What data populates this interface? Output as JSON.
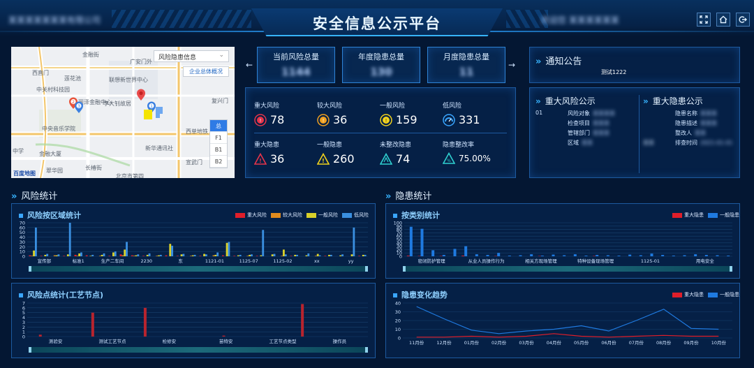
{
  "header": {
    "title": "安全信息公示平台",
    "left_blurred": "某某某某某某某有限公司",
    "right_blurred": "欢迎您 某某某某某某",
    "fullscreen_icon": "expand-icon",
    "home_icon": "home-icon",
    "logout_icon": "logout-icon"
  },
  "map": {
    "select_value": "风险隐患信息",
    "overview_button": "企业总体概况",
    "floors": [
      "总",
      "F1",
      "B1",
      "B2"
    ],
    "labels": [
      {
        "text": "金融街"
      },
      {
        "text": "广安门外"
      },
      {
        "text": "西直门"
      },
      {
        "text": "莲花池"
      },
      {
        "text": "丽泽金融中心"
      },
      {
        "text": "联想新世界中心"
      },
      {
        "text": "中关村科技园"
      },
      {
        "text": "李大钊故居"
      },
      {
        "text": "中央音乐学院"
      },
      {
        "text": "复兴门"
      },
      {
        "text": "新华通讯社"
      },
      {
        "text": "中学"
      },
      {
        "text": "金融大厦"
      },
      {
        "text": "翠华园"
      },
      {
        "text": "长椿街"
      },
      {
        "text": "北京市第四"
      },
      {
        "text": "宣武门"
      },
      {
        "text": "西单地铁"
      },
      {
        "text": "百度地图"
      }
    ],
    "markers": [
      "1",
      "2",
      "3"
    ]
  },
  "kpis": [
    {
      "label": "当前风险总量",
      "value": "1144"
    },
    {
      "label": "年度隐患总量",
      "value": "130"
    },
    {
      "label": "月度隐患总量",
      "value": "11"
    }
  ],
  "risk_stats": [
    {
      "label": "重大风险",
      "value": "78",
      "color": "#e8344a",
      "icon": "major-risk-icon"
    },
    {
      "label": "较大风险",
      "value": "36",
      "color": "#f0a020",
      "icon": "large-risk-icon"
    },
    {
      "label": "一般风险",
      "value": "159",
      "color": "#f2d21c",
      "icon": "general-risk-icon"
    },
    {
      "label": "低风险",
      "value": "331",
      "color": "#3aa6ff",
      "icon": "low-risk-icon"
    }
  ],
  "hazard_stats": [
    {
      "label": "重大隐患",
      "value": "36",
      "color": "#e8344a",
      "icon": "warning-triangle-icon"
    },
    {
      "label": "一般隐患",
      "value": "260",
      "color": "#f2d21c",
      "icon": "warning-triangle-icon"
    },
    {
      "label": "未整改隐患",
      "value": "74",
      "color": "#2fd0d0",
      "icon": "hazard-pending-icon"
    },
    {
      "label": "隐患整改率",
      "value": "75.00%",
      "color": "#2fd0d0",
      "icon": "hazard-rate-icon"
    }
  ],
  "notice": {
    "title": "通知公告",
    "content": "测试1222"
  },
  "major_risk": {
    "title": "重大风险公示",
    "index": "01",
    "rows": [
      {
        "label": "风险对象",
        "value": "某某某某"
      },
      {
        "label": "检查项目",
        "value": "某某某"
      },
      {
        "label": "管辖部门",
        "value": "某某某"
      },
      {
        "label": "区域",
        "value": "某某"
      }
    ]
  },
  "major_hazard": {
    "title": "重大隐患公示",
    "side_value": "某某",
    "rows": [
      {
        "label": "隐患名称",
        "value": "某某某"
      },
      {
        "label": "隐患描述",
        "value": "某某某"
      },
      {
        "label": "整改人",
        "value": "某某"
      },
      {
        "label": "排查时间",
        "value": "2021-01-01"
      }
    ]
  },
  "sections": {
    "risk": "风险统计",
    "hazard": "隐患统计"
  },
  "charts": {
    "region": {
      "title": "风险按区域统计",
      "legend": [
        "重大风险",
        "较大风险",
        "一般风险",
        "低风险"
      ],
      "colors": [
        "#e01e2a",
        "#e08b1e",
        "#d8d02a",
        "#3a8fe0"
      ]
    },
    "point": {
      "title": "风险点统计(工艺节点)"
    },
    "category": {
      "title": "按类别统计",
      "legend": [
        "重大隐患",
        "一般隐患"
      ],
      "colors": [
        "#e01e2a",
        "#1f7ae0"
      ]
    },
    "trend": {
      "title": "隐患变化趋势",
      "legend": [
        "重大隐患",
        "一般隐患"
      ],
      "colors": [
        "#e01e2a",
        "#1f7ae0"
      ]
    }
  },
  "chart_data": [
    {
      "type": "bar",
      "title": "风险按区域统计",
      "ylim": [
        0,
        70
      ],
      "yticks": [
        "70",
        "60",
        "50",
        "40",
        "30",
        "20",
        "10",
        "0"
      ],
      "tick_labels": [
        "宣传部",
        "标准1",
        "生产二车间",
        "2230",
        "东",
        "1121-01",
        "1125-07",
        "1125-02",
        "xx",
        "yy"
      ],
      "series": [
        {
          "name": "重大风险",
          "values": [
            2,
            1,
            0,
            1,
            3,
            2,
            0,
            1,
            4,
            2,
            1,
            0,
            2,
            1,
            0,
            1,
            0,
            2,
            1,
            0,
            1,
            0,
            0,
            1,
            0,
            0,
            1,
            0,
            0,
            1
          ]
        },
        {
          "name": "较大风险",
          "values": [
            1,
            0,
            2,
            0,
            1,
            0,
            1,
            0,
            2,
            1,
            0,
            1,
            0,
            0,
            1,
            0,
            2,
            0,
            0,
            1,
            0,
            0,
            1,
            0,
            0,
            1,
            0,
            0,
            0,
            0
          ]
        },
        {
          "name": "一般风险",
          "values": [
            12,
            3,
            2,
            4,
            6,
            1,
            3,
            8,
            14,
            2,
            3,
            2,
            26,
            4,
            2,
            5,
            3,
            28,
            2,
            3,
            2,
            4,
            14,
            3,
            2,
            5,
            3,
            2,
            4,
            3
          ]
        },
        {
          "name": "低风险",
          "values": [
            60,
            5,
            4,
            70,
            8,
            3,
            6,
            10,
            30,
            4,
            6,
            3,
            22,
            5,
            3,
            4,
            8,
            30,
            3,
            4,
            55,
            5,
            4,
            3,
            6,
            2,
            3,
            4,
            60,
            3
          ]
        }
      ]
    },
    {
      "type": "bar",
      "title": "风险点统计(工艺节点)",
      "ylim": [
        0,
        7
      ],
      "yticks": [
        "7",
        "6",
        "5",
        "4",
        "3",
        "2",
        "1",
        "0"
      ],
      "tick_labels": [
        "测验安",
        "测试工艺节点",
        "检修安",
        "苗特安",
        "工艺节点类型",
        "操作员"
      ],
      "series": [
        {
          "name": "",
          "values": [
            0.4,
            0,
            5,
            0,
            6,
            0,
            0,
            0.2,
            0,
            0,
            6.8,
            0,
            0
          ]
        }
      ]
    },
    {
      "type": "bar",
      "title": "按类别统计",
      "ylim": [
        0,
        100
      ],
      "yticks": [
        "100",
        "90",
        "80",
        "70",
        "60",
        "50",
        "40",
        "30",
        "20",
        "10",
        "0"
      ],
      "tick_labels": [
        "密闭防护管理",
        "从业人员操作行为",
        "相关方现场管理",
        "特种设备现场管理",
        "1125-01",
        "用电安全"
      ],
      "series": [
        {
          "name": "重大隐患",
          "values": [
            2,
            1,
            0,
            1,
            0,
            2,
            0,
            0,
            1,
            0,
            0,
            0,
            1,
            0,
            0,
            0,
            0,
            1,
            0,
            0,
            0,
            0,
            0,
            0,
            0,
            0,
            0,
            0,
            0,
            0
          ]
        },
        {
          "name": "一般隐患",
          "values": [
            88,
            82,
            18,
            4,
            22,
            30,
            6,
            4,
            10,
            2,
            3,
            6,
            2,
            5,
            3,
            6,
            2,
            4,
            3,
            2,
            5,
            3,
            8,
            4,
            2,
            3,
            6,
            4,
            3,
            2
          ]
        }
      ]
    },
    {
      "type": "line",
      "title": "隐患变化趋势",
      "categories": [
        "11月份",
        "12月份",
        "01月份",
        "02月份",
        "03月份",
        "04月份",
        "05月份",
        "06月份",
        "07月份",
        "08月份",
        "09月份",
        "10月份"
      ],
      "ylim": [
        0,
        40
      ],
      "yticks": [
        "40",
        "30",
        "20",
        "10",
        "0"
      ],
      "series": [
        {
          "name": "重大隐患",
          "values": [
            1,
            1,
            2,
            1,
            2,
            5,
            2,
            1,
            2,
            3,
            2,
            2
          ]
        },
        {
          "name": "一般隐患",
          "values": [
            36,
            22,
            9,
            5,
            8,
            10,
            14,
            8,
            20,
            33,
            11,
            10
          ]
        }
      ]
    }
  ]
}
